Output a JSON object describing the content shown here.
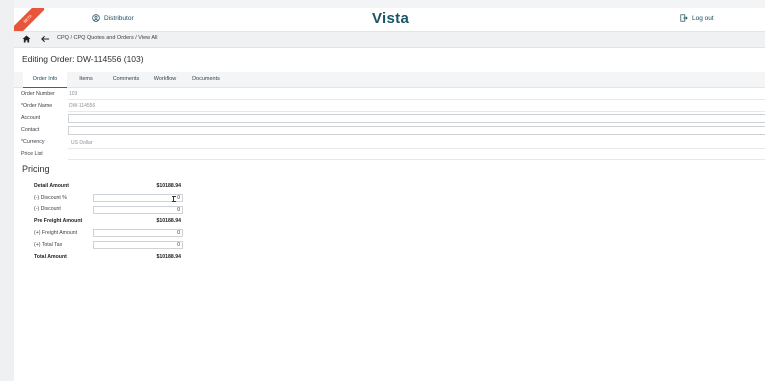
{
  "ribbon": "BETA",
  "header": {
    "distributor": "Distributor",
    "brand": "Vista",
    "logout": "Log out"
  },
  "breadcrumb": "CPQ / CPQ Quotes and Orders / View All",
  "title": "Editing Order: DW-114556 (103)",
  "tabs": [
    "Order Info",
    "Items",
    "Comments",
    "Workflow",
    "Documents"
  ],
  "fields": {
    "order_number": {
      "label": "Order Number",
      "value": "103"
    },
    "order_name": {
      "label": "*Order Name",
      "value": "DW-114556"
    },
    "account": {
      "label": "Account",
      "value": ""
    },
    "contact": {
      "label": "Contact",
      "value": ""
    },
    "currency": {
      "label": "*Currency",
      "value": "US Dollar"
    },
    "price_list": {
      "label": "Price List",
      "value": ""
    }
  },
  "pricing": {
    "heading": "Pricing",
    "detail_amount": {
      "label": "Detail Amount",
      "value": "$10188.94"
    },
    "discount_pct": {
      "label": "(-) Discount %",
      "value": "0"
    },
    "discount": {
      "label": "(-) Discount",
      "value": "0"
    },
    "pre_freight": {
      "label": "Pre Freight Amount",
      "value": "$10188.94"
    },
    "freight": {
      "label": "(+) Freight Amount",
      "value": "0"
    },
    "total_tax": {
      "label": "(+) Total Tax",
      "value": "0"
    },
    "total": {
      "label": "Total Amount",
      "value": "$10188.94"
    }
  },
  "icons": {
    "user": "user-circle-icon",
    "logout": "logout-icon",
    "home": "home-icon",
    "back": "back-arrow-icon"
  }
}
